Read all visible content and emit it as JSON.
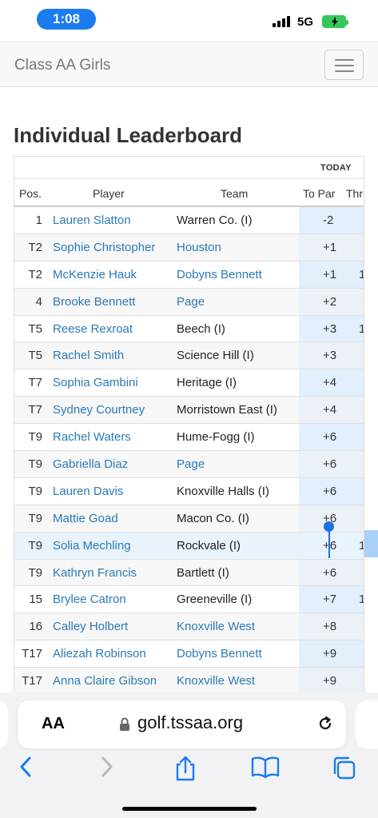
{
  "status_bar": {
    "time": "1:08",
    "network": "5G"
  },
  "navbar": {
    "brand": "Class AA Girls"
  },
  "page": {
    "heading": "Individual Leaderboard"
  },
  "table": {
    "super_header": "TODAY",
    "headers": {
      "pos": "Pos.",
      "player": "Player",
      "team": "Team",
      "to_par": "To Par",
      "thru": "Thr"
    },
    "rows": [
      {
        "pos": "1",
        "player": "Lauren Slatton",
        "team": "Warren Co. (I)",
        "team_link": false,
        "to_par": "-2",
        "thru": ""
      },
      {
        "pos": "T2",
        "player": "Sophie Christopher",
        "team": "Houston",
        "team_link": true,
        "to_par": "+1",
        "thru": ""
      },
      {
        "pos": "T2",
        "player": "McKenzie Hauk",
        "team": "Dobyns Bennett",
        "team_link": true,
        "to_par": "+1",
        "thru": "1"
      },
      {
        "pos": "4",
        "player": "Brooke Bennett",
        "team": "Page",
        "team_link": true,
        "to_par": "+2",
        "thru": ""
      },
      {
        "pos": "T5",
        "player": "Reese Rexroat",
        "team": "Beech (I)",
        "team_link": false,
        "to_par": "+3",
        "thru": "1"
      },
      {
        "pos": "T5",
        "player": "Rachel Smith",
        "team": "Science Hill (I)",
        "team_link": false,
        "to_par": "+3",
        "thru": ""
      },
      {
        "pos": "T7",
        "player": "Sophia Gambini",
        "team": "Heritage (I)",
        "team_link": false,
        "to_par": "+4",
        "thru": ""
      },
      {
        "pos": "T7",
        "player": "Sydney Courtney",
        "team": "Morristown East (I)",
        "team_link": false,
        "to_par": "+4",
        "thru": ""
      },
      {
        "pos": "T9",
        "player": "Rachel Waters",
        "team": "Hume-Fogg (I)",
        "team_link": false,
        "to_par": "+6",
        "thru": ""
      },
      {
        "pos": "T9",
        "player": "Gabriella Diaz",
        "team": "Page",
        "team_link": true,
        "to_par": "+6",
        "thru": ""
      },
      {
        "pos": "T9",
        "player": "Lauren Davis",
        "team": "Knoxville Halls (I)",
        "team_link": false,
        "to_par": "+6",
        "thru": ""
      },
      {
        "pos": "T9",
        "player": "Mattie Goad",
        "team": "Macon Co. (I)",
        "team_link": false,
        "to_par": "+6",
        "thru": ""
      },
      {
        "pos": "T9",
        "player": "Solia Mechling",
        "team": "Rockvale (I)",
        "team_link": false,
        "to_par": "+6",
        "thru": "1"
      },
      {
        "pos": "T9",
        "player": "Kathryn Francis",
        "team": "Bartlett (I)",
        "team_link": false,
        "to_par": "+6",
        "thru": ""
      },
      {
        "pos": "15",
        "player": "Brylee Catron",
        "team": "Greeneville (I)",
        "team_link": false,
        "to_par": "+7",
        "thru": "1"
      },
      {
        "pos": "16",
        "player": "Calley Holbert",
        "team": "Knoxville West",
        "team_link": true,
        "to_par": "+8",
        "thru": ""
      },
      {
        "pos": "T17",
        "player": "Aliezah Robinson",
        "team": "Dobyns Bennett",
        "team_link": true,
        "to_par": "+9",
        "thru": ""
      },
      {
        "pos": "T17",
        "player": "Anna Claire Gibson",
        "team": "Knoxville West",
        "team_link": true,
        "to_par": "+9",
        "thru": ""
      }
    ]
  },
  "browser": {
    "text_size_label": "AA",
    "url": "golf.tssaa.org"
  },
  "colors": {
    "link": "#2a7ab8",
    "accent": "#1a73e8",
    "to_par_column": "#e1f0fc"
  }
}
